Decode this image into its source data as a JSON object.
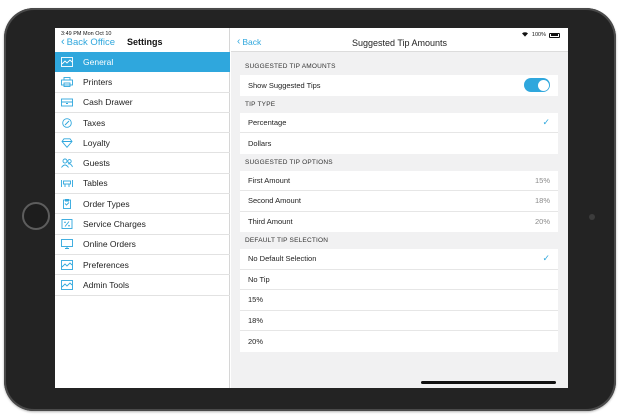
{
  "status": {
    "time": "3:49 PM",
    "date": "Mon Oct 10",
    "battery": "100%"
  },
  "sidebar": {
    "back_label": "Back Office",
    "title": "Settings",
    "items": [
      {
        "label": "General",
        "icon": "general-icon"
      },
      {
        "label": "Printers",
        "icon": "printer-icon"
      },
      {
        "label": "Cash Drawer",
        "icon": "cash-drawer-icon"
      },
      {
        "label": "Taxes",
        "icon": "taxes-icon"
      },
      {
        "label": "Loyalty",
        "icon": "diamond-icon"
      },
      {
        "label": "Guests",
        "icon": "guests-icon"
      },
      {
        "label": "Tables",
        "icon": "tables-icon"
      },
      {
        "label": "Order Types",
        "icon": "clipboard-icon"
      },
      {
        "label": "Service Charges",
        "icon": "percent-icon"
      },
      {
        "label": "Online Orders",
        "icon": "monitor-icon"
      },
      {
        "label": "Preferences",
        "icon": "preferences-icon"
      },
      {
        "label": "Admin Tools",
        "icon": "admin-icon"
      }
    ]
  },
  "main": {
    "back_label": "Back",
    "title": "Suggested Tip Amounts",
    "suggested": {
      "section_title": "SUGGESTED TIP AMOUNTS",
      "toggle_label": "Show Suggested Tips",
      "toggle_on": true
    },
    "tip_type": {
      "section_title": "TIP TYPE",
      "options": [
        "Percentage",
        "Dollars"
      ],
      "selected": "Percentage"
    },
    "tip_options": {
      "section_title": "SUGGESTED TIP OPTIONS",
      "rows": [
        {
          "label": "First Amount",
          "value": "15%"
        },
        {
          "label": "Second Amount",
          "value": "18%"
        },
        {
          "label": "Third Amount",
          "value": "20%"
        }
      ]
    },
    "default_selection": {
      "section_title": "DEFAULT TIP SELECTION",
      "options": [
        "No Default Selection",
        "No Tip",
        "15%",
        "18%",
        "20%"
      ],
      "selected": "No Default Selection"
    }
  },
  "colors": {
    "accent": "#2fa7dd",
    "background": "#f1f1f2"
  }
}
